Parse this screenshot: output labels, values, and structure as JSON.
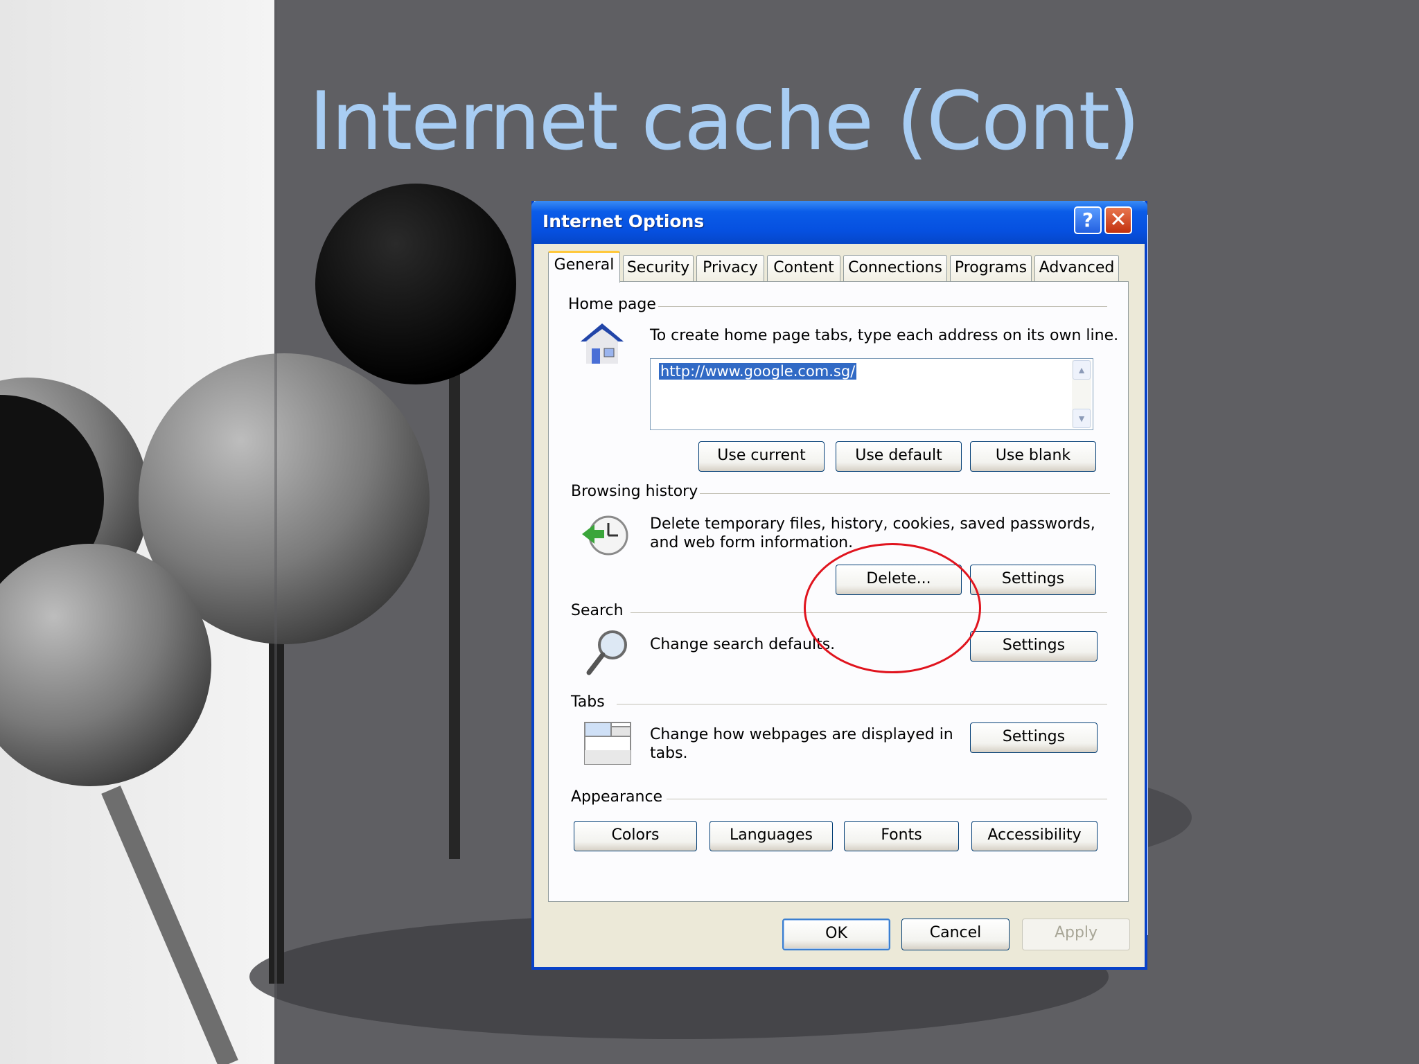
{
  "slide": {
    "title": "Internet cache (Cont)"
  },
  "dialog": {
    "title": "Internet Options",
    "help_label": "?",
    "close_label": "✕",
    "tabs": [
      {
        "label": "General"
      },
      {
        "label": "Security"
      },
      {
        "label": "Privacy"
      },
      {
        "label": "Content"
      },
      {
        "label": "Connections"
      },
      {
        "label": "Programs"
      },
      {
        "label": "Advanced"
      }
    ],
    "home_page": {
      "heading": "Home page",
      "description": "To create home page tabs, type each address on its own line.",
      "url_value": "http://www.google.com.sg/",
      "buttons": {
        "use_current": "Use current",
        "use_default": "Use default",
        "use_blank": "Use blank"
      }
    },
    "browsing_history": {
      "heading": "Browsing history",
      "description_line1": "Delete temporary files, history, cookies, saved passwords,",
      "description_line2": "and web form information.",
      "buttons": {
        "delete": "Delete...",
        "settings": "Settings"
      }
    },
    "search": {
      "heading": "Search",
      "description": "Change search defaults.",
      "buttons": {
        "settings": "Settings"
      }
    },
    "tabs_section": {
      "heading": "Tabs",
      "description_line1": "Change how webpages are displayed in",
      "description_line2": "tabs.",
      "buttons": {
        "settings": "Settings"
      }
    },
    "appearance": {
      "heading": "Appearance",
      "buttons": {
        "colors": "Colors",
        "languages": "Languages",
        "fonts": "Fonts",
        "accessibility": "Accessibility"
      }
    },
    "footer": {
      "ok": "OK",
      "cancel": "Cancel",
      "apply": "Apply"
    }
  },
  "colors": {
    "title_text": "#a8cdf3",
    "xp_blue": "#0842c8",
    "highlight_circle": "#e0141e"
  }
}
